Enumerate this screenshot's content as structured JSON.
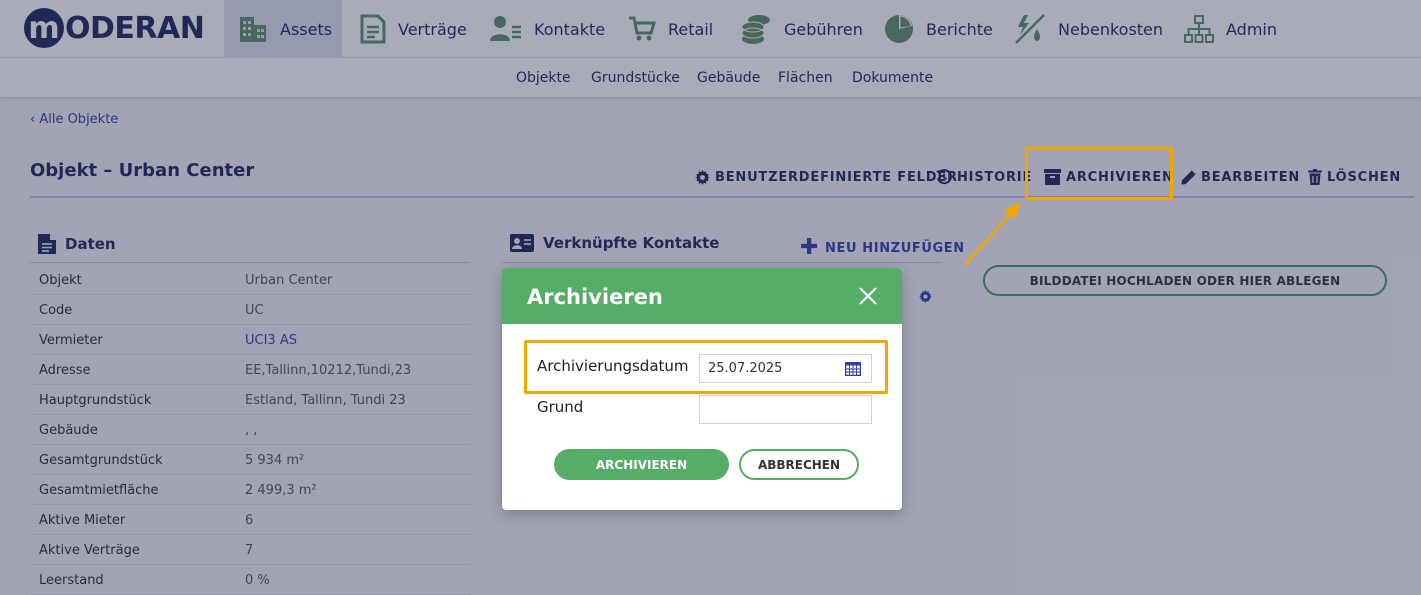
{
  "logo": {
    "mark": "m",
    "text": "ODERAN"
  },
  "nav": {
    "assets": "Assets",
    "vertraege": "Verträge",
    "kontakte": "Kontakte",
    "retail": "Retail",
    "gebuehren": "Gebühren",
    "berichte": "Berichte",
    "nebenkosten": "Nebenkosten",
    "admin": "Admin"
  },
  "subnav": {
    "objekte": "Objekte",
    "grundstuecke": "Grundstücke",
    "gebaeude": "Gebäude",
    "flaechen": "Flächen",
    "dokumente": "Dokumente"
  },
  "breadcrumb": "‹ Alle Objekte",
  "page_title": "Objekt – Urban Center",
  "actions": {
    "custom_fields": "BENUTZERDEFINIERTE FELDER",
    "history": "HISTORIE",
    "archive": "ARCHIVIEREN",
    "edit": "BEARBEITEN",
    "delete": "LÖSCHEN"
  },
  "data_section": {
    "title": "Daten",
    "rows": [
      {
        "label": "Objekt",
        "value": "Urban Center"
      },
      {
        "label": "Code",
        "value": "UC"
      },
      {
        "label": "Vermieter",
        "value": "UCI3 AS"
      },
      {
        "label": "Adresse",
        "value": "EE,Tallinn,10212,Tundi,23"
      },
      {
        "label": "Hauptgrundstück",
        "value": "Estland, Tallinn, Tundi 23"
      },
      {
        "label": "Gebäude",
        "value": ", ,"
      },
      {
        "label": "Gesamtgrundstück",
        "value": "5 934 m²"
      },
      {
        "label": "Gesamtmietfläche",
        "value": "2 499,3 m²"
      },
      {
        "label": "Aktive Mieter",
        "value": "6"
      },
      {
        "label": "Aktive Verträge",
        "value": "7"
      },
      {
        "label": "Leerstand",
        "value": "0 %"
      }
    ]
  },
  "contacts_section": {
    "title": "Verknüpfte Kontakte",
    "add_label": "NEU HINZUFÜGEN"
  },
  "upload_label": "BILDDATEI HOCHLADEN ODER HIER ABLEGEN",
  "modal": {
    "title": "Archivieren",
    "date_label": "Archivierungsdatum",
    "date_value": "25.07.2025",
    "reason_label": "Grund",
    "reason_value": "",
    "confirm_label": "ARCHIVIEREN",
    "cancel_label": "ABBRECHEN"
  },
  "colors": {
    "brand": "#1d2559",
    "accent_green": "#56ad67",
    "highlight": "#f0a800",
    "link": "#2f3fa6"
  }
}
